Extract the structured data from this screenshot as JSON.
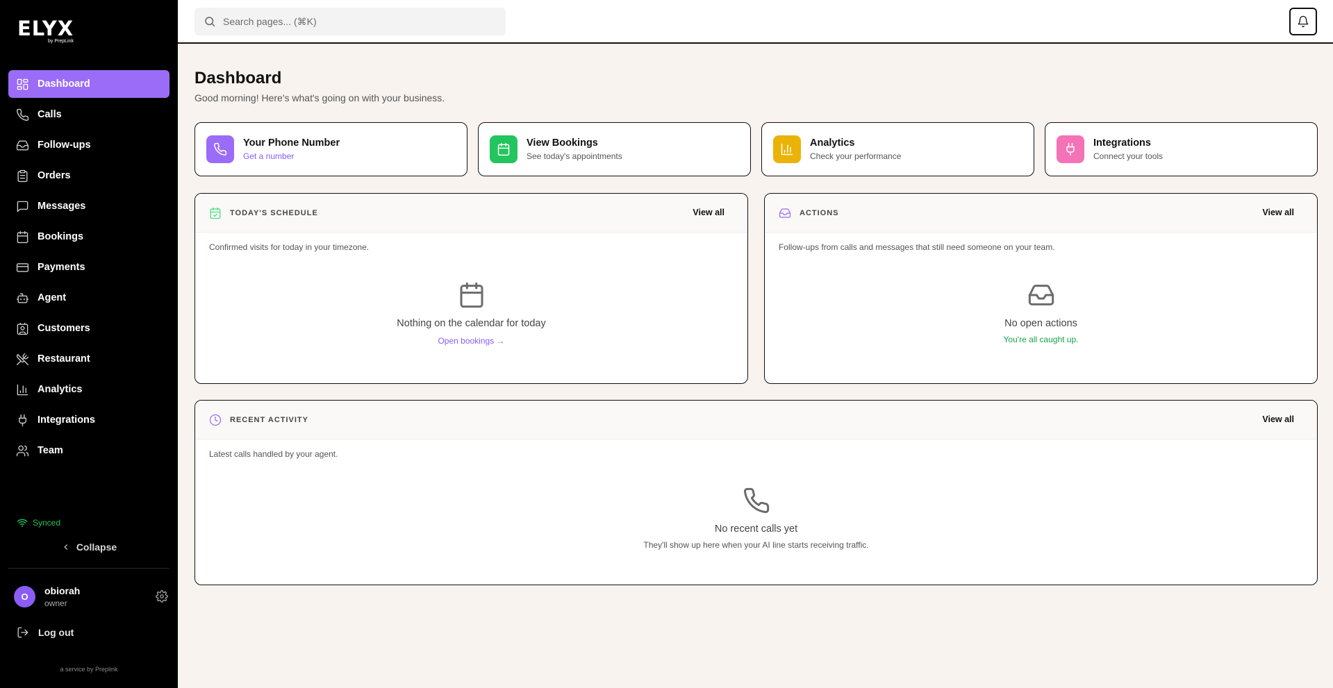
{
  "brand": {
    "name": "ELYX",
    "byline": "by PrepLink"
  },
  "sidebar": {
    "items": [
      {
        "label": "Dashboard",
        "icon": "grid-icon",
        "active": true
      },
      {
        "label": "Calls",
        "icon": "phone-icon"
      },
      {
        "label": "Follow-ups",
        "icon": "inbox-icon"
      },
      {
        "label": "Orders",
        "icon": "clipboard-icon"
      },
      {
        "label": "Messages",
        "icon": "message-icon"
      },
      {
        "label": "Bookings",
        "icon": "calendar-icon"
      },
      {
        "label": "Payments",
        "icon": "credit-card-icon"
      },
      {
        "label": "Agent",
        "icon": "bot-icon"
      },
      {
        "label": "Customers",
        "icon": "contact-icon"
      },
      {
        "label": "Restaurant",
        "icon": "utensils-icon"
      },
      {
        "label": "Analytics",
        "icon": "chart-icon"
      },
      {
        "label": "Integrations",
        "icon": "plug-icon"
      },
      {
        "label": "Team",
        "icon": "users-icon"
      }
    ],
    "status": "Synced",
    "collapse_label": "Collapse",
    "user": {
      "initial": "O",
      "name": "obiorah",
      "role": "owner"
    },
    "logout_label": "Log out",
    "footer": "a service by Preplink"
  },
  "topbar": {
    "search_placeholder": "Search pages... (⌘K)"
  },
  "main": {
    "title": "Dashboard",
    "subtitle": "Good morning! Here's what's going on with your business.",
    "quick_actions": [
      {
        "title": "Your Phone Number",
        "subtitle": "Get a number",
        "color": "#9b6cf7",
        "icon": "phone-icon"
      },
      {
        "title": "View Bookings",
        "subtitle": "See today's appointments",
        "color": "#22c55e",
        "icon": "calendar-icon"
      },
      {
        "title": "Analytics",
        "subtitle": "Check your performance",
        "color": "#eab308",
        "icon": "chart-icon"
      },
      {
        "title": "Integrations",
        "subtitle": "Connect your tools",
        "color": "#f472b6",
        "icon": "plug-icon"
      }
    ],
    "schedule": {
      "title": "TODAY'S SCHEDULE",
      "view_all": "View all",
      "description": "Confirmed visits for today in your timezone.",
      "empty_title": "Nothing on the calendar for today",
      "empty_link": "Open bookings →"
    },
    "actions": {
      "title": "ACTIONS",
      "view_all": "View all",
      "description": "Follow-ups from calls and messages that still need someone on your team.",
      "empty_title": "No open actions",
      "empty_note": "You're all caught up."
    },
    "activity": {
      "title": "RECENT ACTIVITY",
      "view_all": "View all",
      "description": "Latest calls handled by your agent.",
      "empty_title": "No recent calls yet",
      "empty_note": "They'll show up here when your AI line starts receiving traffic."
    }
  },
  "colors": {
    "accent": "#9b6cf7",
    "success": "#22c55e",
    "background": "#f8f3ef"
  }
}
